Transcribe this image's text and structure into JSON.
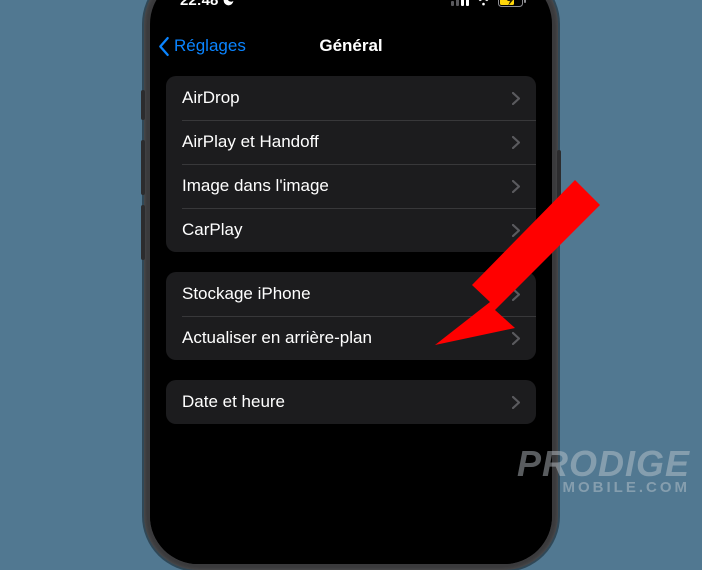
{
  "status": {
    "time": "22:48"
  },
  "nav": {
    "back_label": "Réglages",
    "title": "Général"
  },
  "groups": [
    {
      "rows": [
        {
          "label": "AirDrop"
        },
        {
          "label": "AirPlay et Handoff"
        },
        {
          "label": "Image dans l'image"
        },
        {
          "label": "CarPlay"
        }
      ]
    },
    {
      "rows": [
        {
          "label": "Stockage iPhone"
        },
        {
          "label": "Actualiser en arrière-plan"
        }
      ]
    },
    {
      "rows": [
        {
          "label": "Date et heure"
        }
      ]
    }
  ],
  "watermark": {
    "line1": "PRODIGE",
    "line2": "MOBILE.COM"
  }
}
